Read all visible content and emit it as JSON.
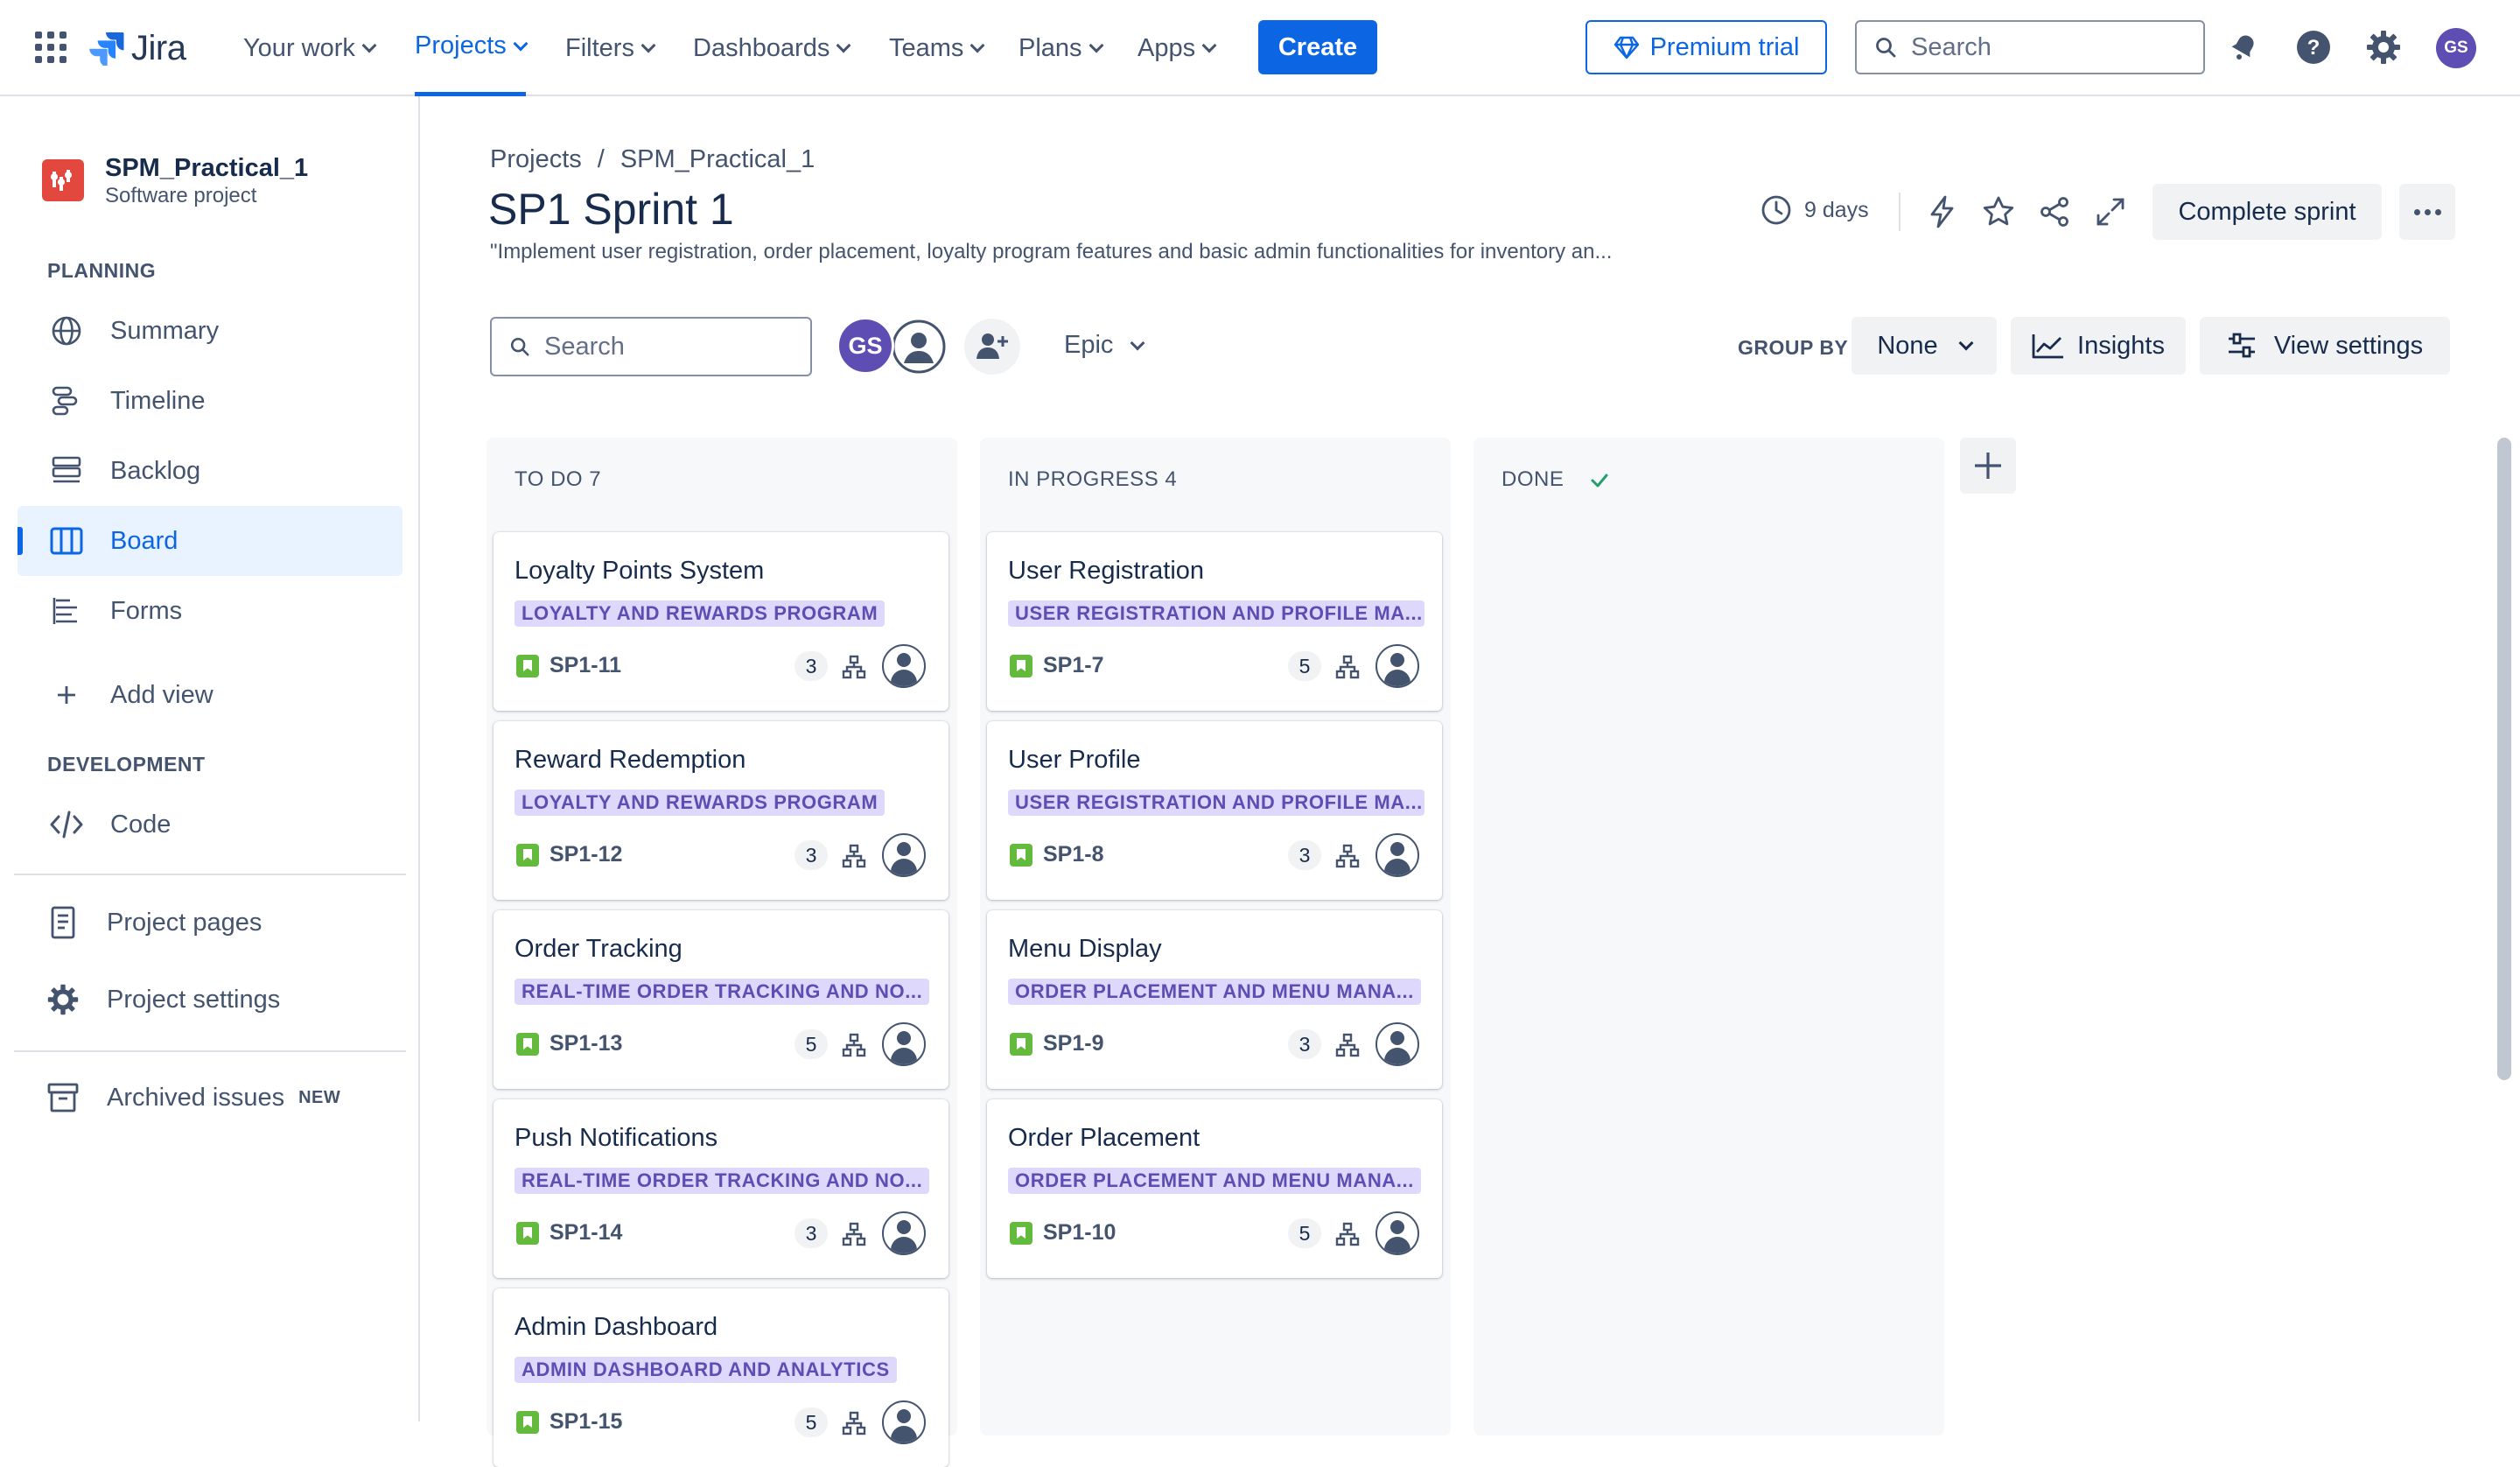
{
  "topnav": {
    "logo": "Jira",
    "items": [
      {
        "label": "Your work"
      },
      {
        "label": "Projects"
      },
      {
        "label": "Filters"
      },
      {
        "label": "Dashboards"
      },
      {
        "label": "Teams"
      },
      {
        "label": "Plans"
      },
      {
        "label": "Apps"
      }
    ],
    "create_label": "Create",
    "premium_label": "Premium trial",
    "search_placeholder": "Search",
    "user_initials": "GS"
  },
  "sidebar": {
    "project_name": "SPM_Practical_1",
    "project_type": "Software project",
    "planning_heading": "PLANNING",
    "planning_items": [
      {
        "label": "Summary",
        "icon": "globe-icon"
      },
      {
        "label": "Timeline",
        "icon": "timeline-icon"
      },
      {
        "label": "Backlog",
        "icon": "backlog-icon"
      },
      {
        "label": "Board",
        "icon": "board-icon"
      },
      {
        "label": "Forms",
        "icon": "forms-icon"
      }
    ],
    "add_view_label": "Add view",
    "development_heading": "DEVELOPMENT",
    "code_label": "Code",
    "project_pages_label": "Project pages",
    "project_settings_label": "Project settings",
    "archived_label": "Archived issues",
    "new_badge": "NEW"
  },
  "header": {
    "breadcrumb": [
      "Projects",
      "SPM_Practical_1"
    ],
    "breadcrumb_sep": "/",
    "title": "SP1 Sprint 1",
    "goal": "\"Implement user registration, order placement, loyalty program features and basic admin functionalities for inventory an...",
    "days_remaining": "9 days",
    "complete_label": "Complete sprint"
  },
  "toolbar": {
    "search_placeholder": "Search",
    "avatar_initials": "GS",
    "epic_label": "Epic",
    "group_by_label": "GROUP BY",
    "group_by_value": "None",
    "insights_label": "Insights",
    "view_settings_label": "View settings"
  },
  "columns": [
    {
      "title": "TO DO 7",
      "cards": [
        {
          "title": "Loyalty Points System",
          "epic": "LOYALTY AND REWARDS PROGRAM",
          "key": "SP1-11",
          "estimate": "3"
        },
        {
          "title": "Reward Redemption",
          "epic": "LOYALTY AND REWARDS PROGRAM",
          "key": "SP1-12",
          "estimate": "3"
        },
        {
          "title": "Order Tracking",
          "epic": "REAL-TIME ORDER TRACKING AND NO...",
          "key": "SP1-13",
          "estimate": "5"
        },
        {
          "title": "Push Notifications",
          "epic": "REAL-TIME ORDER TRACKING AND NO...",
          "key": "SP1-14",
          "estimate": "3"
        },
        {
          "title": "Admin Dashboard",
          "epic": "ADMIN DASHBOARD AND ANALYTICS",
          "key": "SP1-15",
          "estimate": "5"
        }
      ]
    },
    {
      "title": "IN PROGRESS 4",
      "cards": [
        {
          "title": "User Registration",
          "epic": "USER REGISTRATION AND PROFILE MA...",
          "key": "SP1-7",
          "estimate": "5"
        },
        {
          "title": "User Profile",
          "epic": "USER REGISTRATION AND PROFILE MA...",
          "key": "SP1-8",
          "estimate": "3"
        },
        {
          "title": "Menu Display",
          "epic": "ORDER PLACEMENT AND MENU MANA...",
          "key": "SP1-9",
          "estimate": "3"
        },
        {
          "title": "Order Placement",
          "epic": "ORDER PLACEMENT AND MENU MANA...",
          "key": "SP1-10",
          "estimate": "5"
        }
      ]
    },
    {
      "title": "DONE",
      "cards": []
    }
  ],
  "colors": {
    "brand_blue": "#0c66e4",
    "epic_bg": "#dfd8fd",
    "epic_text": "#5e4db2",
    "story_green": "#63ba3c",
    "done_check": "#22a06b"
  }
}
